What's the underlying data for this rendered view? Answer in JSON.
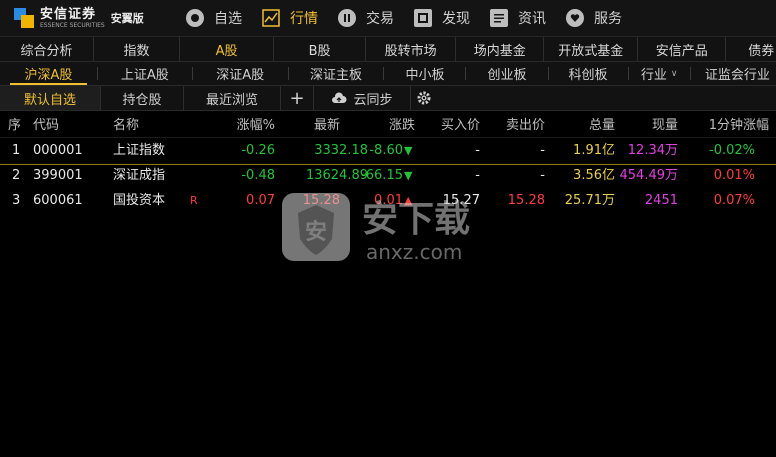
{
  "app": {
    "brand_cn": "安信证券",
    "brand_en": "ESSENCE SECURITIES",
    "edition": "安翼版"
  },
  "nav": [
    {
      "label": "自选",
      "icon": "star-circle-icon"
    },
    {
      "label": "行情",
      "icon": "chart-icon",
      "active": true
    },
    {
      "label": "交易",
      "icon": "trade-icon"
    },
    {
      "label": "发现",
      "icon": "discover-icon"
    },
    {
      "label": "资讯",
      "icon": "news-icon"
    },
    {
      "label": "服务",
      "icon": "service-icon"
    }
  ],
  "tabs_main": [
    "综合分析",
    "指数",
    "A股",
    "B股",
    "股转市场",
    "场内基金",
    "开放式基金",
    "安信产品",
    "债券"
  ],
  "tabs_main_active": "A股",
  "tabs_sub": [
    "沪深A股",
    "上证A股",
    "深证A股",
    "深证主板",
    "中小板",
    "创业板",
    "科创板",
    "行业",
    "证监会行业"
  ],
  "tabs_sub_active": "沪深A股",
  "tabs_list": {
    "default": "默认自选",
    "holdings": "持仓股",
    "recent": "最近浏览",
    "add": "+",
    "sync": "云同步"
  },
  "table": {
    "headers": [
      "序",
      "代码",
      "名称",
      "涨幅%",
      "最新",
      "涨跌",
      "买入价",
      "卖出价",
      "总量",
      "现量",
      "1分钟涨幅"
    ],
    "rows": [
      {
        "seq": "1",
        "code": "000001",
        "name": "上证指数",
        "flag": "",
        "pct": "-0.26",
        "last": "3332.18",
        "chg": "-8.60",
        "dir": "down",
        "bid": "-",
        "ask": "-",
        "vol": "1.91亿",
        "cur": "12.34万",
        "min1": "-0.02%"
      },
      {
        "seq": "2",
        "code": "399001",
        "name": "深证成指",
        "flag": "",
        "pct": "-0.48",
        "last": "13624.89",
        "chg": "-66.15",
        "dir": "down",
        "bid": "-",
        "ask": "-",
        "vol": "3.56亿",
        "cur": "454.49万",
        "min1": "0.01%"
      },
      {
        "seq": "3",
        "code": "600061",
        "name": "国投资本",
        "flag": "R",
        "pct": "0.07",
        "last": "15.28",
        "chg": "0.01",
        "dir": "up",
        "bid": "15.27",
        "ask": "15.28",
        "vol": "25.71万",
        "cur": "2451",
        "min1": "0.07%"
      }
    ]
  },
  "watermark": {
    "text_cn": "安下载",
    "text_en": "anxz.com"
  },
  "colors": {
    "accent": "#f0c030",
    "up": "#ff3b3b",
    "down": "#22c33a",
    "volume": "#e8d04a",
    "current": "#e040e0"
  }
}
